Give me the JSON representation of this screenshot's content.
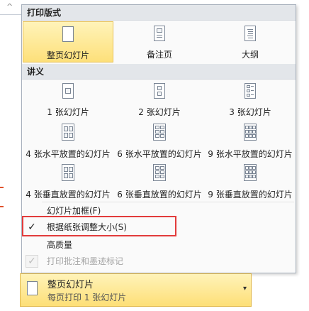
{
  "sections": {
    "print_layout": "打印版式",
    "handouts": "讲义"
  },
  "print_layout_items": [
    {
      "label": "整页幻灯片",
      "icon": "full-page-slide-icon",
      "selected": true
    },
    {
      "label": "备注页",
      "icon": "notes-page-icon",
      "selected": false
    },
    {
      "label": "大纲",
      "icon": "outline-icon",
      "selected": false
    }
  ],
  "handout_items": [
    {
      "label": "1 张幻灯片",
      "icon": "handout-1-slide-icon"
    },
    {
      "label": "2 张幻灯片",
      "icon": "handout-2-slides-icon"
    },
    {
      "label": "3 张幻灯片",
      "icon": "handout-3-slides-icon"
    },
    {
      "label": "4 张水平放置的幻灯片",
      "icon": "handout-4-horizontal-icon"
    },
    {
      "label": "6 张水平放置的幻灯片",
      "icon": "handout-6-horizontal-icon"
    },
    {
      "label": "9 张水平放置的幻灯片",
      "icon": "handout-9-horizontal-icon"
    },
    {
      "label": "4 张垂直放置的幻灯片",
      "icon": "handout-4-vertical-icon"
    },
    {
      "label": "6 张垂直放置的幻灯片",
      "icon": "handout-6-vertical-icon"
    },
    {
      "label": "9 张垂直放置的幻灯片",
      "icon": "handout-9-vertical-icon"
    }
  ],
  "options": [
    {
      "label": "幻灯片加框(F)",
      "checked": false,
      "disabled": false
    },
    {
      "label": "根据纸张调整大小(S)",
      "checked": true,
      "disabled": false
    },
    {
      "label": "高质量",
      "checked": false,
      "disabled": false
    },
    {
      "label": "打印批注和墨迹标记",
      "checked": true,
      "disabled": true
    }
  ],
  "check_glyph": "✓",
  "dropdown": {
    "title": "整页幻灯片",
    "subtitle": "每页打印 1 张幻灯片",
    "arrow": "▾"
  },
  "left_strip": {
    "chevron": "^"
  },
  "colors": {
    "selected_bg": "#fde07a",
    "highlight_border": "#e23b3b",
    "header_bg": "#e3e6ea"
  }
}
